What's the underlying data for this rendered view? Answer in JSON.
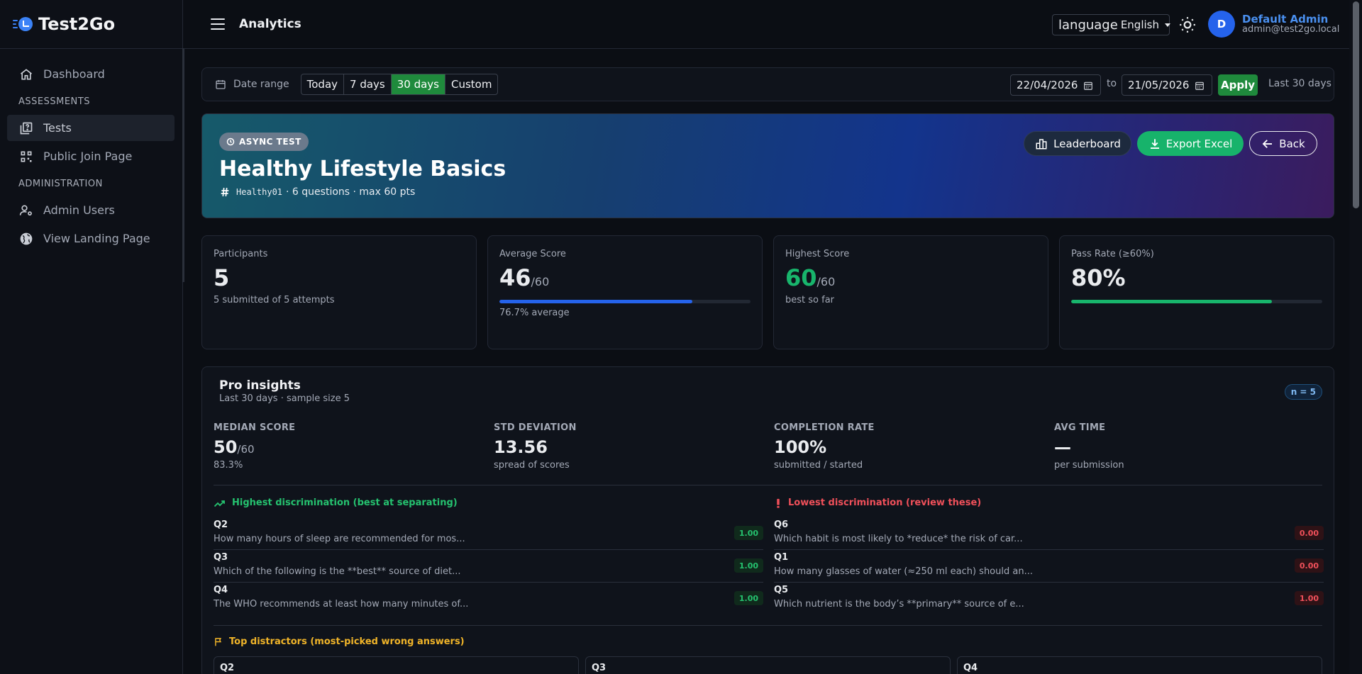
{
  "app": {
    "name": "Test2Go"
  },
  "sidebar": {
    "items": [
      {
        "label": "Dashboard"
      },
      {
        "section": "ASSESSMENTS"
      },
      {
        "label": "Tests"
      },
      {
        "label": "Public Join Page"
      },
      {
        "section": "ADMINISTRATION"
      },
      {
        "label": "Admin Users"
      },
      {
        "label": "View Landing Page"
      }
    ]
  },
  "header": {
    "title": "Analytics",
    "language_key": "language",
    "language_value": "English",
    "avatar_initial": "D",
    "user_name": "Default Admin",
    "user_email": "admin@test2go.local"
  },
  "daterange": {
    "label": "Date range",
    "presets": [
      "Today",
      "7 days",
      "30 days",
      "Custom"
    ],
    "active_preset": "30 days",
    "from": "22/04/2026",
    "to_label": "to",
    "to": "21/05/2026",
    "apply_label": "Apply",
    "summary": "Last 30 days"
  },
  "hero": {
    "badge": "ASYNC TEST",
    "title": "Healthy Lifestyle Basics",
    "code": "Healthy01",
    "meta": "· 6 questions · max 60 pts",
    "buttons": {
      "leaderboard": "Leaderboard",
      "export": "Export Excel",
      "back": "Back"
    }
  },
  "stats": {
    "participants": {
      "label": "Participants",
      "value": "5",
      "sub": "5 submitted of 5 attempts"
    },
    "average": {
      "label": "Average Score",
      "value": "46",
      "max": "/60",
      "sub": "76.7% average",
      "progress": 0.767
    },
    "highest": {
      "label": "Highest Score",
      "value": "60",
      "max": "/60",
      "sub": "best so far"
    },
    "pass_rate": {
      "label": "Pass Rate (≥60%)",
      "value": "80%",
      "progress": 0.8
    }
  },
  "pro": {
    "title": "Pro insights",
    "subtitle": "Last 30 days · sample size 5",
    "n_badge": "n = 5",
    "metrics": {
      "median": {
        "label": "MEDIAN SCORE",
        "value": "50",
        "max": "/60",
        "sub": "83.3%"
      },
      "std": {
        "label": "STD DEVIATION",
        "value": "13.56",
        "sub": "spread of scores"
      },
      "completion": {
        "label": "COMPLETION RATE",
        "value": "100%",
        "sub": "submitted / started"
      },
      "avg_time": {
        "label": "AVG TIME",
        "value": "—",
        "sub": "per submission"
      }
    },
    "highest_disc": {
      "title": "Highest discrimination (best at separating)",
      "rows": [
        {
          "q": "Q2",
          "text": "How many hours of sleep are recommended for mos...",
          "value": "1.00"
        },
        {
          "q": "Q3",
          "text": "Which of the following is the **best** source of diet...",
          "value": "1.00"
        },
        {
          "q": "Q4",
          "text": "The WHO recommends at least how many minutes of...",
          "value": "1.00"
        }
      ]
    },
    "lowest_disc": {
      "title": "Lowest discrimination (review these)",
      "rows": [
        {
          "q": "Q6",
          "text": "Which habit is most likely to *reduce* the risk of car...",
          "value": "0.00"
        },
        {
          "q": "Q1",
          "text": "How many glasses of water (≈250 ml each) should an...",
          "value": "0.00"
        },
        {
          "q": "Q5",
          "text": "Which nutrient is the body’s **primary** source of e...",
          "value": "1.00"
        }
      ]
    },
    "distractors": {
      "title": "Top distractors (most-picked wrong answers)",
      "cards": [
        "Q2",
        "Q3",
        "Q4"
      ]
    }
  },
  "colors": {
    "accent_green": "#1f8a3c",
    "primary_blue": "#2563eb",
    "success": "#18b56c",
    "danger": "#f0505a",
    "warning": "#f0b429"
  }
}
